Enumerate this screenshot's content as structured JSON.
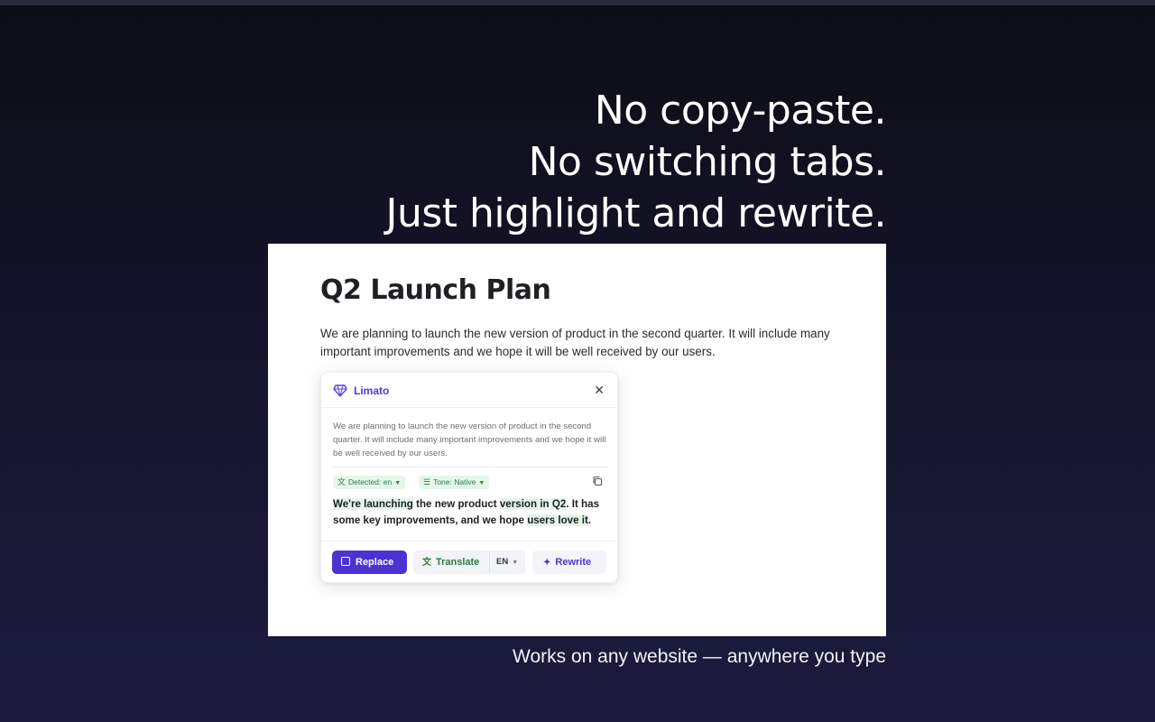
{
  "headline": {
    "line1": "No copy-paste.",
    "line2": "No switching tabs.",
    "line3": "Just highlight and rewrite."
  },
  "document": {
    "title": "Q2 Launch Plan",
    "body": "We are planning to launch the new version of product in the second quarter. It will include many important improvements and we hope it will be well received by our users."
  },
  "popup": {
    "brand": "Limato",
    "close_glyph": "✕",
    "original_text": "We are planning to launch the new version of product in the second quarter. It will include many important improvements and we hope it will be well received by our users.",
    "detected_label": "Detected: en",
    "tone_label": "Tone: Native",
    "result_parts": [
      "We're launching",
      " the new product ",
      "version in Q2",
      ". It has some key improvements, and we hope ",
      "users love it",
      "."
    ],
    "buttons": {
      "replace": "Replace",
      "translate": "Translate",
      "language": "EN",
      "rewrite": "Rewrite"
    },
    "icons": {
      "brand": "diamond-icon",
      "close": "close-icon",
      "detected": "translate-icon",
      "tone": "sliders-icon",
      "copy": "copy-icon",
      "replace": "replace-icon",
      "translate": "translate-icon",
      "rewrite": "sparkle-icon"
    },
    "colors": {
      "accent": "#4a33d0",
      "chip_bg": "#e6f7ea",
      "chip_text": "#2f7a45",
      "highlight": "#e3f6e6"
    }
  },
  "caption": "Works on any website — anywhere you type"
}
